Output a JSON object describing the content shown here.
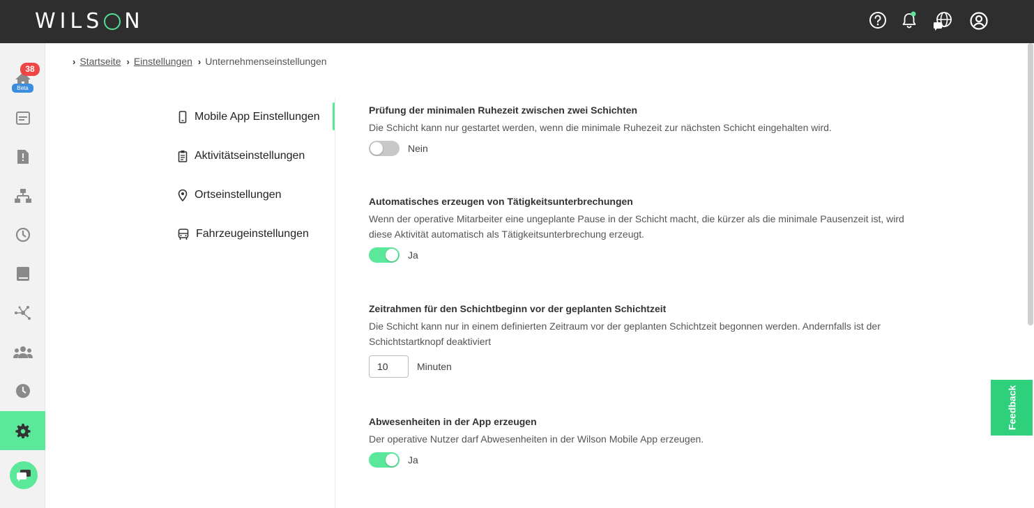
{
  "app": {
    "logo_text_left": "WILS",
    "logo_text_right": "N",
    "accent": "#5ce89b"
  },
  "header": {
    "icons": [
      "help-icon",
      "bell-icon",
      "globe-icon",
      "account-icon"
    ]
  },
  "sidebar": {
    "badge_count": "38",
    "beta_label": "Beta",
    "items": [
      "home-icon",
      "schedule-icon",
      "report-icon",
      "org-chart-icon",
      "clock-icon",
      "book-icon",
      "network-icon",
      "users-icon",
      "history-icon",
      "settings-icon"
    ]
  },
  "breadcrumb": {
    "home": "Startseite",
    "settings": "Einstellungen",
    "current": "Unternehmenseinstellungen"
  },
  "leftnav": {
    "items": [
      {
        "label": "Mobile App Einstellungen",
        "icon": "phone-icon"
      },
      {
        "label": "Aktivitätseinstellungen",
        "icon": "clipboard-icon"
      },
      {
        "label": "Ortseinstellungen",
        "icon": "location-icon"
      },
      {
        "label": "Fahrzeugeinstellungen",
        "icon": "vehicle-icon"
      }
    ]
  },
  "sections": [
    {
      "title": "Prüfung der minimalen Ruhezeit zwischen zwei Schichten",
      "desc": "Die Schicht kann nur gestartet werden, wenn die minimale Ruhezeit zur nächsten Schicht eingehalten wird.",
      "toggle_on": false,
      "toggle_label": "Nein"
    },
    {
      "title": "Automatisches erzeugen von Tätigkeitsunterbrechungen",
      "desc": "Wenn der operative Mitarbeiter eine ungeplante Pause in der Schicht macht, die kürzer als die minimale Pausenzeit ist, wird diese Aktivität automatisch als Tätigkeitsunterbrechung erzeugt.",
      "toggle_on": true,
      "toggle_label": "Ja"
    },
    {
      "title": "Zeitrahmen für den Schichtbeginn vor der geplanten Schichtzeit",
      "desc": "Die Schicht kann nur in einem definierten Zeitraum vor der geplanten Schichtzeit begonnen werden. Andernfalls ist der Schichtstartknopf deaktiviert",
      "value": "10",
      "unit": "Minuten"
    },
    {
      "title": "Abwesenheiten in der App erzeugen",
      "desc": "Der operative Nutzer darf Abwesenheiten in der Wilson Mobile App erzeugen.",
      "toggle_on": true,
      "toggle_label": "Ja"
    }
  ],
  "feedback_label": "Feedback"
}
